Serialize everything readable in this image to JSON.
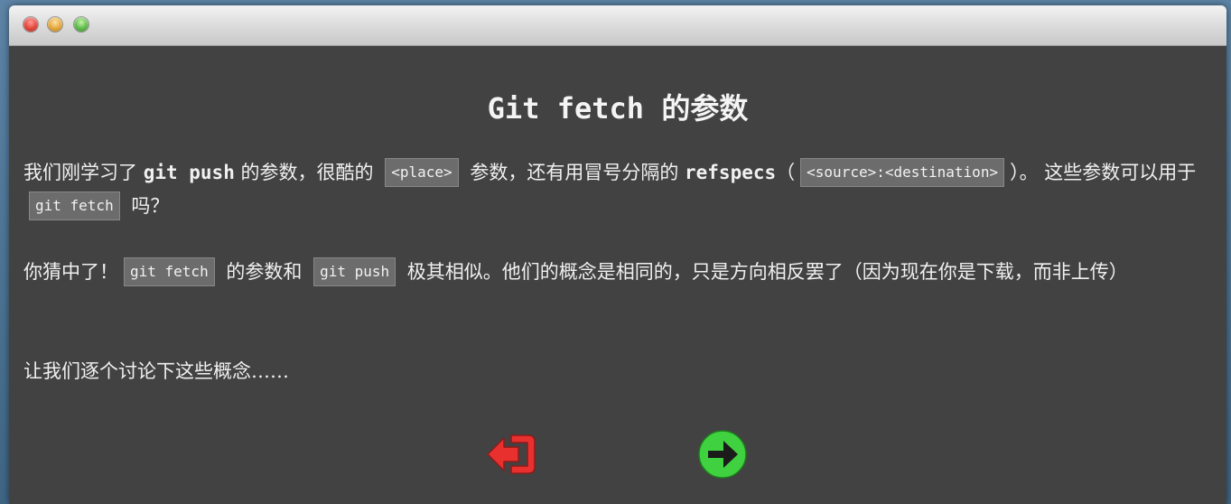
{
  "window": {
    "controls": [
      "close",
      "minimize",
      "maximize"
    ]
  },
  "dialog": {
    "title": "Git fetch 的参数",
    "p1": {
      "t1": "我们刚学习了 ",
      "kw1": "git push",
      "t2": " 的参数，很酷的 ",
      "code1": "<place>",
      "t3": " 参数，还有用冒号分隔的 ",
      "kw2": "refspecs",
      "t4": "（",
      "code2": "<source>:<destination>",
      "t5": "）。 这些参数可以用于 ",
      "code3": "git fetch",
      "t6": " 吗？"
    },
    "p2": {
      "t1": "你猜中了！",
      "code1": "git fetch",
      "t2": " 的参数和 ",
      "code2": "git push",
      "t3": " 极其相似。他们的概念是相同的，只是方向相反罢了（因为现在你是下载，而非上传）"
    },
    "p3": "让我们逐个讨论下这些概念……"
  },
  "nav": {
    "back_icon": "exit-left-icon",
    "next_icon": "arrow-right-circle-icon",
    "back_color": "#e8312f",
    "next_color": "#3fd13f"
  }
}
